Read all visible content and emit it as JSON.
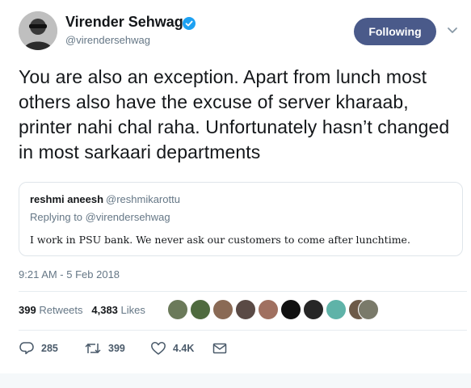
{
  "author": {
    "name": "Virender Sehwag",
    "handle": "@virendersehwag",
    "verified": true,
    "avatar_icon": "user-avatar"
  },
  "follow_button": {
    "label": "Following",
    "color": "#4a5a8a"
  },
  "tweet": {
    "text": "You are also an exception. Apart from lunch most others also have the excuse of server kharaab, printer nahi chal raha. Unfortunately hasn’t changed in most sarkaari departments",
    "timestamp": "9:21 AM - 5 Feb 2018"
  },
  "quoted_tweet": {
    "name": "reshmi aneesh",
    "handle": "@reshmikarottu",
    "replying_to": "Replying to @virendersehwag",
    "text": "I work in PSU bank. We never ask our customers to come after lunchtime."
  },
  "stats": {
    "retweets_count": "399",
    "retweets_label": "Retweets",
    "likes_count": "4,383",
    "likes_label": "Likes"
  },
  "actions": {
    "reply_count": "285",
    "retweet_count": "399",
    "like_count": "4.4K"
  },
  "colors": {
    "text": "#14171a",
    "secondary": "#657786",
    "verified": "#1da1f2",
    "border": "#dfe5ea"
  }
}
